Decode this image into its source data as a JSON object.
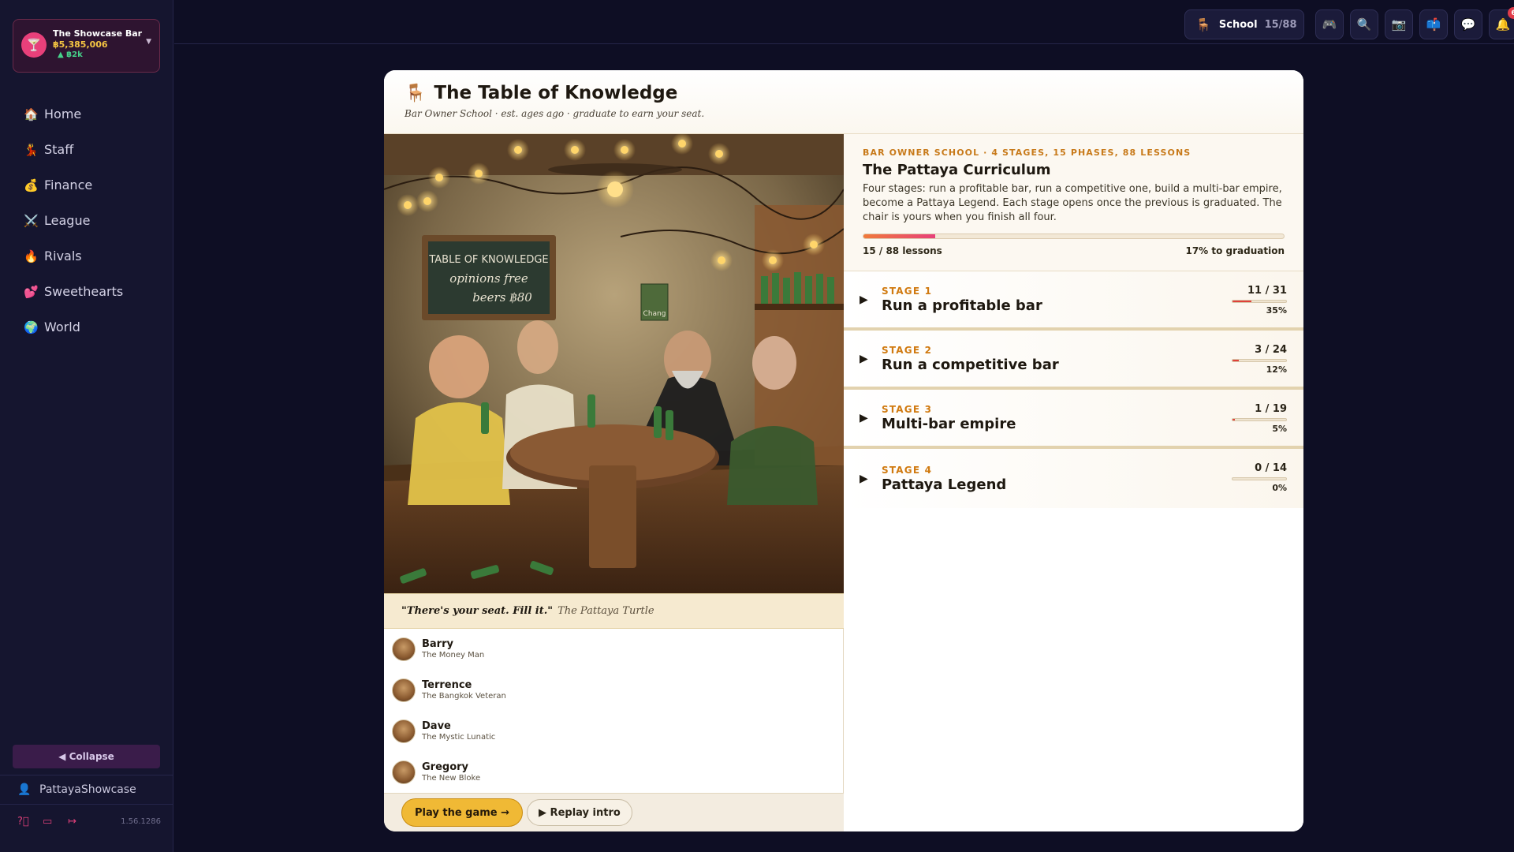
{
  "bar": {
    "name": "The Showcase Bar",
    "money": "฿5,385,006",
    "delta": "▲ ฿2k"
  },
  "nav": [
    {
      "icon": "🏠",
      "label": "Home"
    },
    {
      "icon": "💃",
      "label": "Staff"
    },
    {
      "icon": "💰",
      "label": "Finance"
    },
    {
      "icon": "⚔️",
      "label": "League"
    },
    {
      "icon": "🔥",
      "label": "Rivals"
    },
    {
      "icon": "💕",
      "label": "Sweethearts"
    },
    {
      "icon": "🌍",
      "label": "World"
    }
  ],
  "sidebar": {
    "collapse": "◀ Collapse",
    "username": "PattayaShowcase",
    "version": "1.56.1286"
  },
  "topbar": {
    "school_label": "School",
    "school_count": "15/88",
    "notif_count": "6"
  },
  "panel": {
    "title": "The Table of Knowledge",
    "subtitle": "Bar Owner School · est. ages ago · graduate to earn your seat.",
    "chalkboard_line1": "TABLE OF KNOWLEDGE",
    "chalkboard_line2": "opinions free",
    "chalkboard_line3": "beers ฿80",
    "poster_text": "Chang",
    "quote": "\"There's your seat. Fill it.\"",
    "quote_by": "The Pattaya Turtle",
    "characters": [
      {
        "name": "Barry",
        "role": "The Money Man"
      },
      {
        "name": "Terrence",
        "role": "The Bangkok Veteran"
      },
      {
        "name": "Dave",
        "role": "The Mystic Lunatic"
      },
      {
        "name": "Gregory",
        "role": "The New Bloke"
      }
    ],
    "play_label": "Play the game →",
    "replay_label": "▶ Replay intro"
  },
  "curriculum": {
    "kicker": "BAR OWNER SCHOOL · 4 STAGES, 15 PHASES, 88 LESSONS",
    "title": "The Pattaya Curriculum",
    "description": "Four stages: run a profitable bar, run a competitive one, build a multi-bar empire, become a Pattaya Legend. Each stage opens once the previous is graduated. The chair is yours when you finish all four.",
    "progress_fraction": 0.17,
    "lessons_text": "15 / 88 lessons",
    "graduation_text": "17% to graduation"
  },
  "stages": [
    {
      "num": "STAGE 1",
      "name": "Run a profitable bar",
      "count": "11 / 31",
      "pct": "35%",
      "fraction": 0.35
    },
    {
      "num": "STAGE 2",
      "name": "Run a competitive bar",
      "count": "3 / 24",
      "pct": "12%",
      "fraction": 0.12
    },
    {
      "num": "STAGE 3",
      "name": "Multi-bar empire",
      "count": "1 / 19",
      "pct": "5%",
      "fraction": 0.05
    },
    {
      "num": "STAGE 4",
      "name": "Pattaya Legend",
      "count": "0 / 14",
      "pct": "0%",
      "fraction": 0.0
    }
  ]
}
